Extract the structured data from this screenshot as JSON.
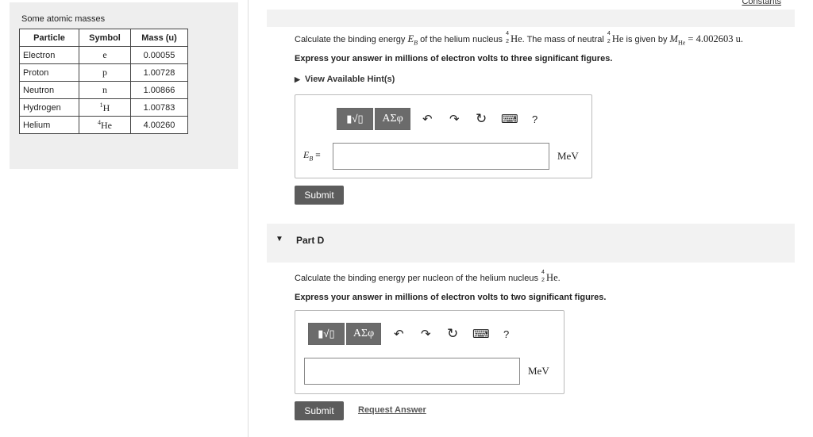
{
  "constants_link": "Constants",
  "masses_table": {
    "title": "Some atomic masses",
    "headers": [
      "Particle",
      "Symbol",
      "Mass (u)"
    ],
    "rows": [
      {
        "particle": "Electron",
        "symbol": "e",
        "mass": "0.00055"
      },
      {
        "particle": "Proton",
        "symbol": "p",
        "mass": "1.00728"
      },
      {
        "particle": "Neutron",
        "symbol": "n",
        "mass": "1.00866"
      },
      {
        "particle": "Hydrogen",
        "symbol_sup": "1",
        "symbol": "H",
        "mass": "1.00783"
      },
      {
        "particle": "Helium",
        "symbol_sup": "4",
        "symbol": "He",
        "mass": "4.00260"
      }
    ]
  },
  "part_c": {
    "question_a": "Calculate the binding energy ",
    "var_E": "E",
    "var_sub": "B",
    "question_b": " of the helium nucleus ",
    "nucleus_A": "4",
    "nucleus_Z": "2",
    "nucleus_sym": "He",
    "question_c": ". The mass of neutral ",
    "question_d": " is given by ",
    "mass_var": "M",
    "mass_sub": "He",
    "mass_value": " = 4.002603 u.",
    "instruction": "Express your answer in millions of electron volts to three significant figures.",
    "hint": "View Available Hint(s)",
    "input_label_E": "E",
    "input_label_sub": "B",
    "input_label_eq": " =",
    "input_value": "",
    "unit": "MeV",
    "submit": "Submit"
  },
  "part_d": {
    "title": "Part D",
    "question_a": "Calculate the binding energy per nucleon of the helium nucleus ",
    "nucleus_A": "4",
    "nucleus_Z": "2",
    "nucleus_sym": "He",
    "question_b": ".",
    "instruction": "Express your answer in millions of electron volts to two significant figures.",
    "input_value": "",
    "unit": "MeV",
    "submit": "Submit",
    "request_answer": "Request Answer"
  },
  "toolbar": {
    "template_label": "▮√▯",
    "symbols_label": "ΑΣφ",
    "undo": "↶",
    "redo": "↷",
    "reset": "↻",
    "keyboard": "⌨",
    "help": "?"
  }
}
